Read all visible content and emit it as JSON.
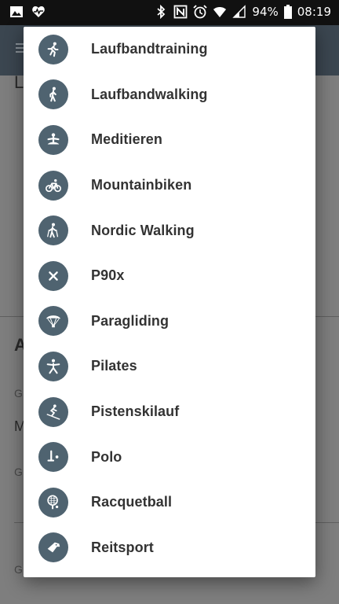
{
  "status_bar": {
    "battery": "94%",
    "time": "08:19",
    "left_icons": [
      "image-icon",
      "heart-rate-icon"
    ],
    "right_icons": [
      "bluetooth-icon",
      "nfc-icon",
      "alarm-icon",
      "wifi-icon",
      "signal-icon",
      "battery-icon"
    ]
  },
  "background": {
    "letters": [
      "L",
      "A",
      "G",
      "M",
      "G",
      "G"
    ]
  },
  "dialog": {
    "items": [
      {
        "label": "Laufbandtraining",
        "icon": "running-icon"
      },
      {
        "label": "Laufbandwalking",
        "icon": "walking-icon"
      },
      {
        "label": "Meditieren",
        "icon": "meditation-icon"
      },
      {
        "label": "Mountainbiken",
        "icon": "bicycle-icon"
      },
      {
        "label": "Nordic Walking",
        "icon": "nordic-walking-icon"
      },
      {
        "label": "P90x",
        "icon": "close-x-icon"
      },
      {
        "label": "Paragliding",
        "icon": "paraglider-icon"
      },
      {
        "label": "Pilates",
        "icon": "pilates-icon"
      },
      {
        "label": "Pistenskilauf",
        "icon": "skiing-icon"
      },
      {
        "label": "Polo",
        "icon": "polo-icon"
      },
      {
        "label": "Racquetball",
        "icon": "racquet-icon"
      },
      {
        "label": "Reitsport",
        "icon": "horse-riding-icon"
      }
    ]
  },
  "colors": {
    "icon_circle": "#4f6370",
    "label_text": "#333333",
    "toolbar": "#3b4650"
  }
}
